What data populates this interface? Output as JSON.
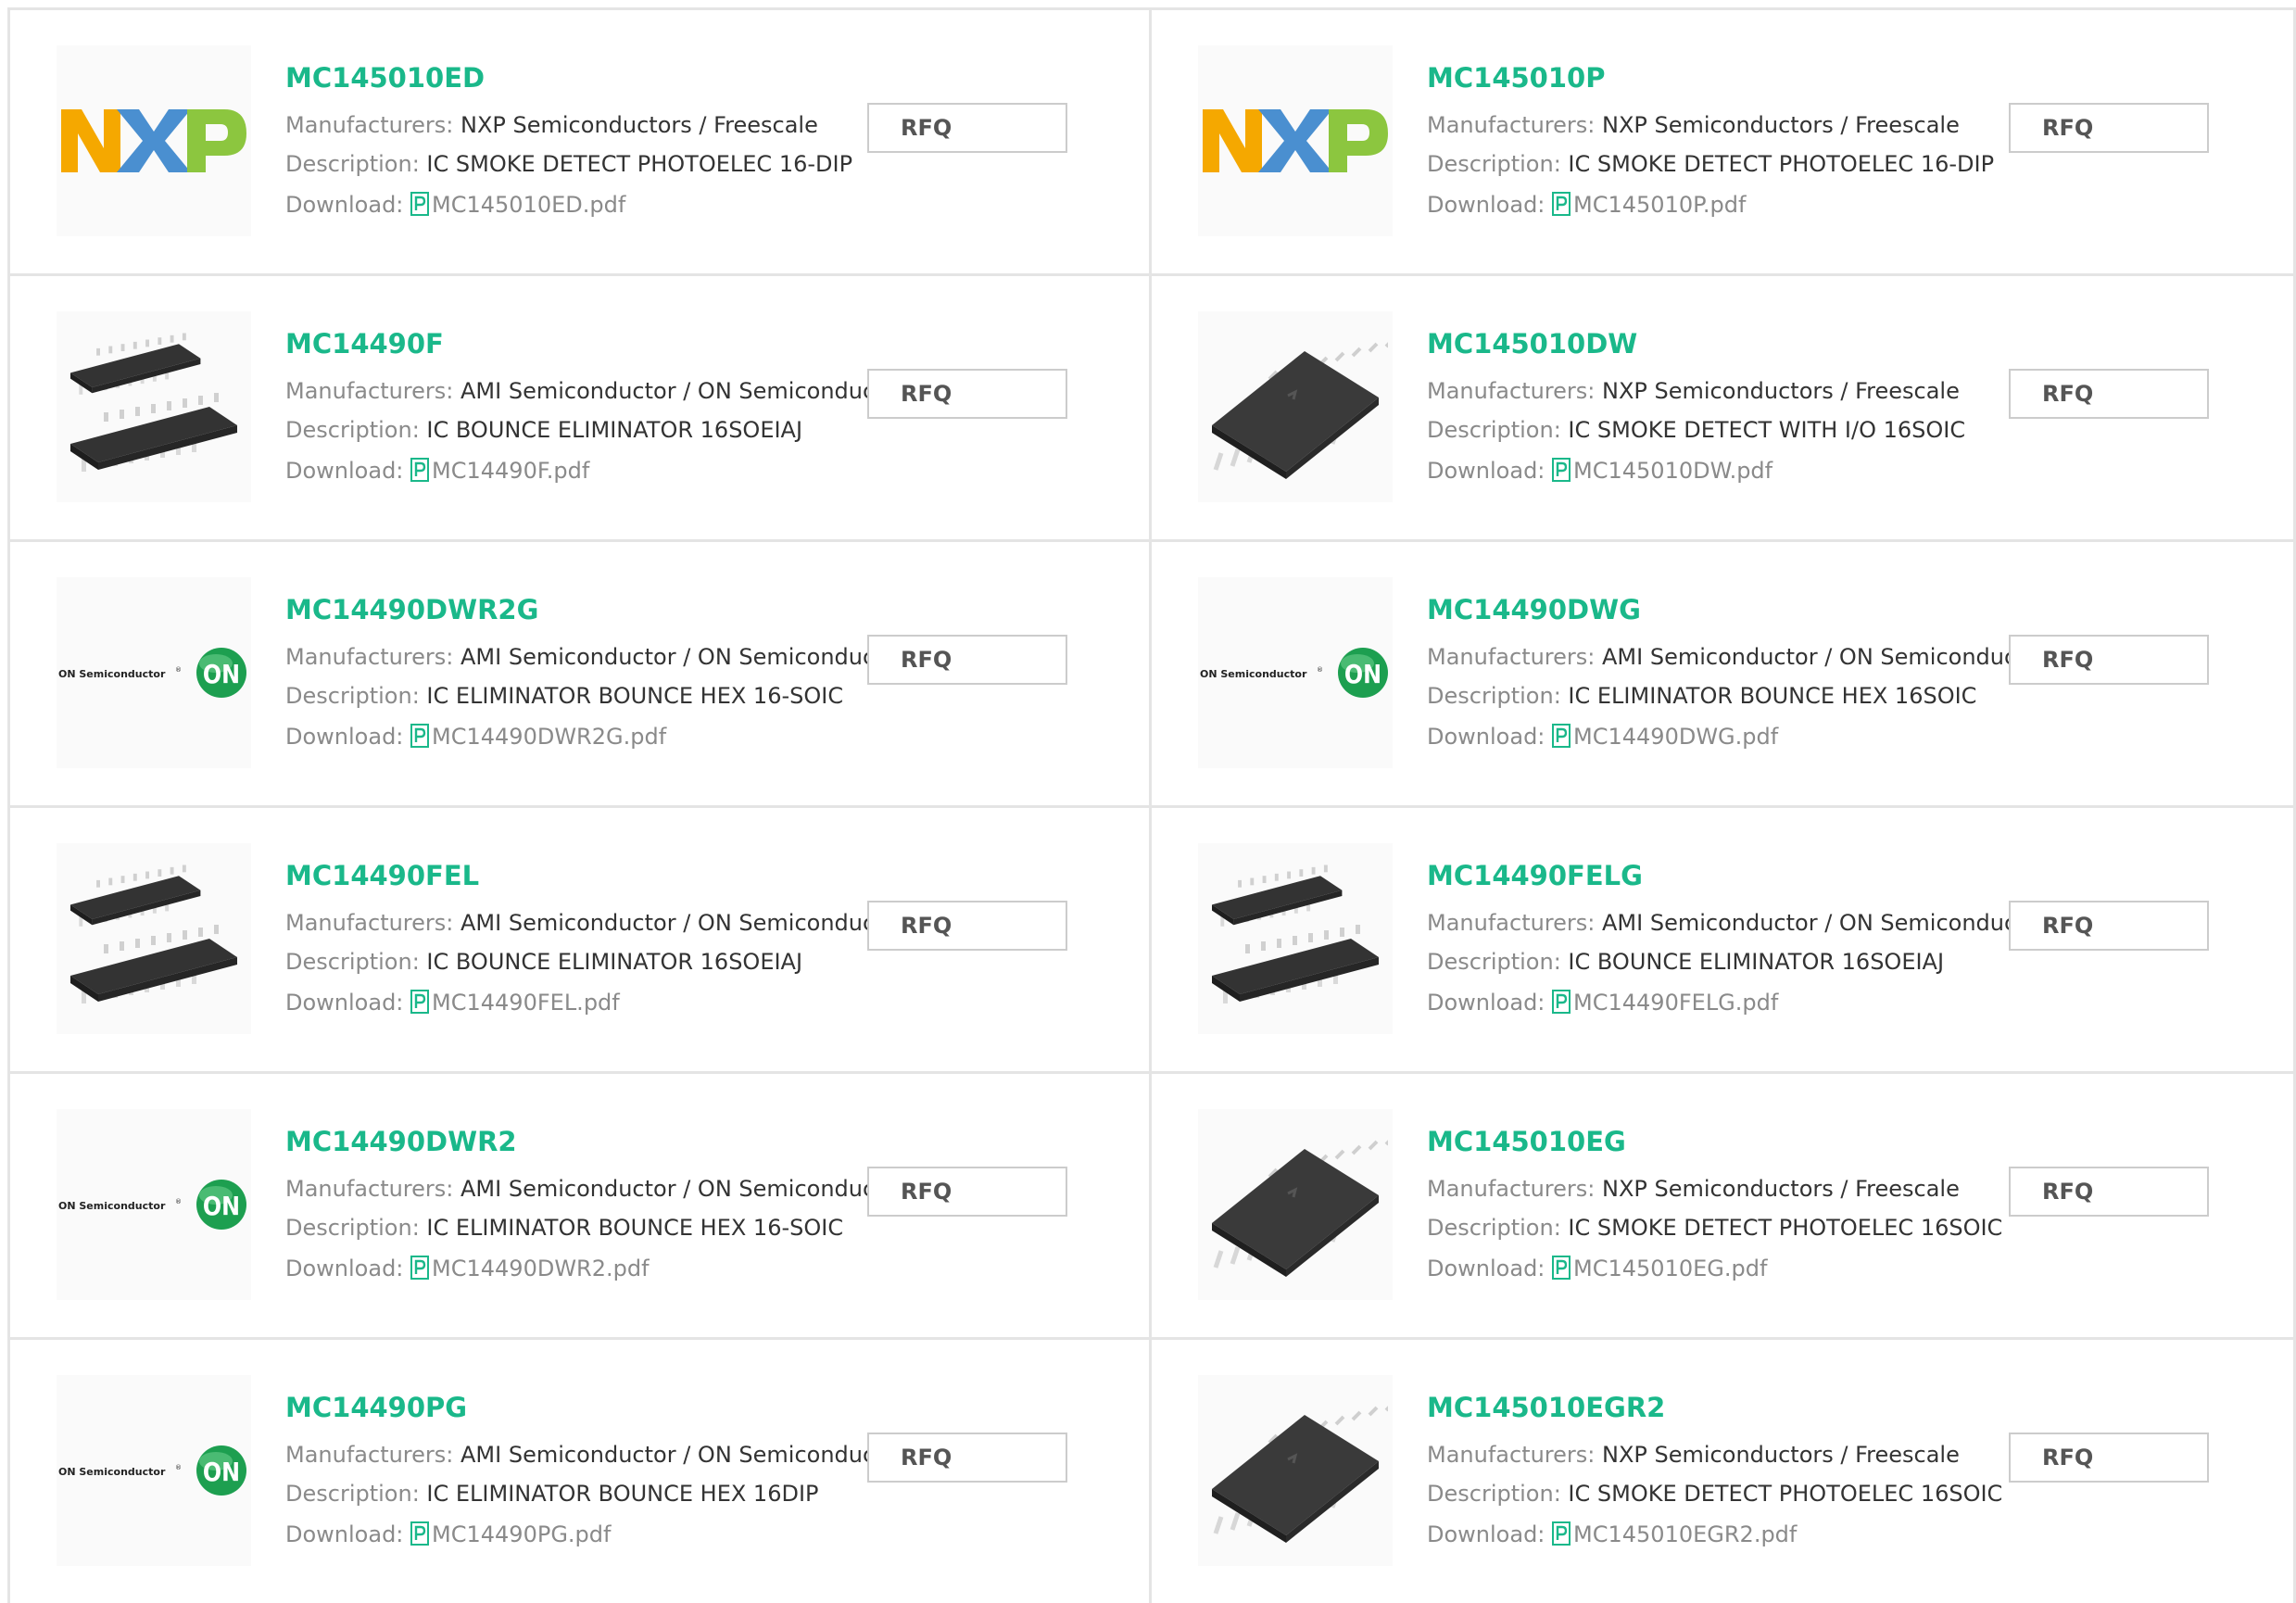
{
  "labels": {
    "manufacturers": "Manufacturers:",
    "description": "Description:",
    "download": "Download:",
    "rfq": "RFQ"
  },
  "colors": {
    "accent": "#1ab88a",
    "label": "#8a8a8a",
    "value": "#333333",
    "border": "#e4e4e4"
  },
  "products": [
    {
      "part": "MC145010ED",
      "manufacturer": "NXP Semiconductors / Freescale",
      "description": "IC SMOKE DETECT PHOTOELEC 16-DIP",
      "pdf": "MC145010ED.pdf",
      "image": "nxp-logo"
    },
    {
      "part": "MC145010P",
      "manufacturer": "NXP Semiconductors / Freescale",
      "description": "IC SMOKE DETECT PHOTOELEC 16-DIP",
      "pdf": "MC145010P.pdf",
      "image": "nxp-logo"
    },
    {
      "part": "MC14490F",
      "manufacturer": "AMI Semiconductor / ON Semiconductor",
      "description": "IC BOUNCE ELIMINATOR 16SOEIAJ",
      "pdf": "MC14490F.pdf",
      "image": "dual-soic-chip"
    },
    {
      "part": "MC145010DW",
      "manufacturer": "NXP Semiconductors / Freescale",
      "description": "IC SMOKE DETECT WITH I/O 16SOIC",
      "pdf": "MC145010DW.pdf",
      "image": "soic-chip"
    },
    {
      "part": "MC14490DWR2G",
      "manufacturer": "AMI Semiconductor / ON Semiconductor",
      "description": "IC ELIMINATOR BOUNCE HEX 16-SOIC",
      "pdf": "MC14490DWR2G.pdf",
      "image": "on-semi-logo"
    },
    {
      "part": "MC14490DWG",
      "manufacturer": "AMI Semiconductor / ON Semiconductor",
      "description": "IC ELIMINATOR BOUNCE HEX 16SOIC",
      "pdf": "MC14490DWG.pdf",
      "image": "on-semi-logo"
    },
    {
      "part": "MC14490FEL",
      "manufacturer": "AMI Semiconductor / ON Semiconductor",
      "description": "IC BOUNCE ELIMINATOR 16SOEIAJ",
      "pdf": "MC14490FEL.pdf",
      "image": "dual-soic-chip"
    },
    {
      "part": "MC14490FELG",
      "manufacturer": "AMI Semiconductor / ON Semiconductor",
      "description": "IC BOUNCE ELIMINATOR 16SOEIAJ",
      "pdf": "MC14490FELG.pdf",
      "image": "dual-soic-chip"
    },
    {
      "part": "MC14490DWR2",
      "manufacturer": "AMI Semiconductor / ON Semiconductor",
      "description": "IC ELIMINATOR BOUNCE HEX 16-SOIC",
      "pdf": "MC14490DWR2.pdf",
      "image": "on-semi-logo"
    },
    {
      "part": "MC145010EG",
      "manufacturer": "NXP Semiconductors / Freescale",
      "description": "IC SMOKE DETECT PHOTOELEC 16SOIC",
      "pdf": "MC145010EG.pdf",
      "image": "soic-chip"
    },
    {
      "part": "MC14490PG",
      "manufacturer": "AMI Semiconductor / ON Semiconductor",
      "description": "IC ELIMINATOR BOUNCE HEX 16DIP",
      "pdf": "MC14490PG.pdf",
      "image": "on-semi-logo"
    },
    {
      "part": "MC145010EGR2",
      "manufacturer": "NXP Semiconductors / Freescale",
      "description": "IC SMOKE DETECT PHOTOELEC 16SOIC",
      "pdf": "MC145010EGR2.pdf",
      "image": "soic-chip"
    }
  ],
  "logo_text": {
    "nxp": "NXP",
    "on_semi_word": "ON Semiconductor",
    "on_badge": "ON"
  }
}
